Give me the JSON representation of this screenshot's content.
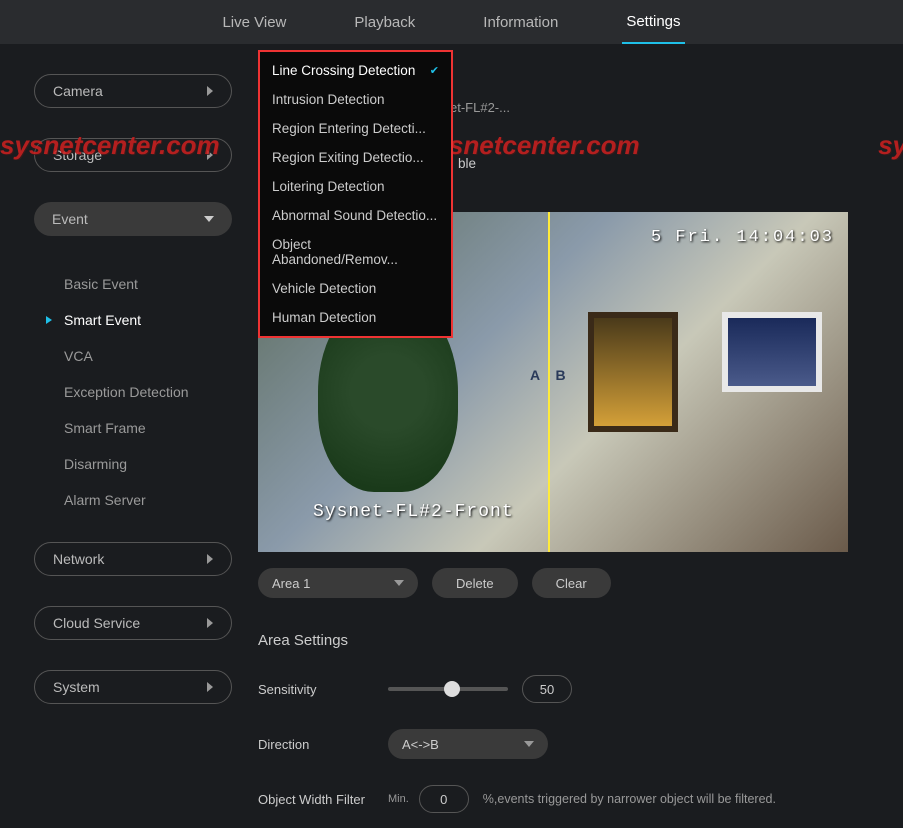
{
  "topnav": {
    "live": "Live View",
    "playback": "Playback",
    "info": "Information",
    "settings": "Settings"
  },
  "sidebar": {
    "camera": "Camera",
    "storage": "Storage",
    "event": "Event",
    "event_items": {
      "basic": "Basic Event",
      "smart": "Smart Event",
      "vca": "VCA",
      "exception": "Exception Detection",
      "smartframe": "Smart Frame",
      "disarming": "Disarming",
      "alarmserver": "Alarm Server"
    },
    "network": "Network",
    "cloud": "Cloud Service",
    "system": "System"
  },
  "dropdown": {
    "items": [
      "Line Crossing Detection",
      "Intrusion Detection",
      "Region Entering Detecti...",
      "Region Exiting Detectio...",
      "Loitering Detection",
      "Abnormal Sound Detectio...",
      "Object Abandoned/Remov...",
      "Vehicle Detection",
      "Human Detection"
    ]
  },
  "channel_partial": "et-FL#2-...",
  "enable": "ble",
  "preview": {
    "timestamp": "5 Fri. 14:04:03",
    "label": "Sysnet-FL#2-Front",
    "ab": "A   B"
  },
  "controls": {
    "area": "Area 1",
    "delete": "Delete",
    "clear": "Clear"
  },
  "section": "Area Settings",
  "form": {
    "sensitivity_label": "Sensitivity",
    "sensitivity_value": "50",
    "direction_label": "Direction",
    "direction_value": "A<->B",
    "width_label": "Object Width Filter",
    "width_min": "Min.",
    "width_value": "0",
    "width_hint": "%,events triggered by narrower object will be filtered."
  },
  "watermark": "sysnetcenter.com",
  "watermark_cut": "sy"
}
